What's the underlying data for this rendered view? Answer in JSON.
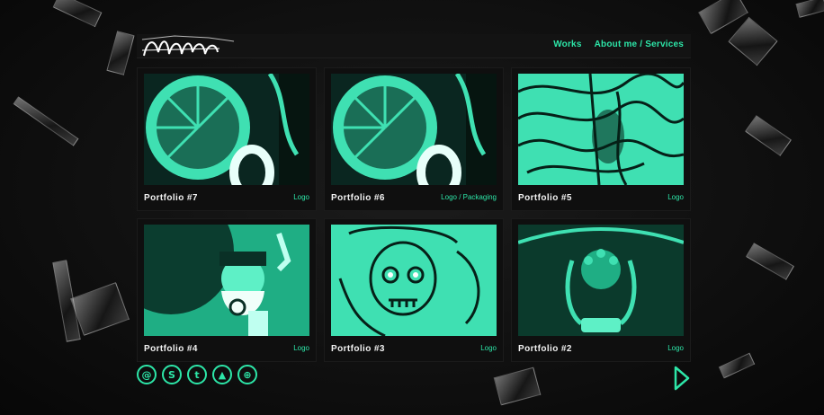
{
  "site": {
    "logo_alt": "logo"
  },
  "nav": {
    "items": [
      {
        "label": "Works"
      },
      {
        "label": "About me / Services"
      }
    ]
  },
  "colors": {
    "accent": "#2de6a8",
    "background": "#0c0c0c",
    "card": "#0f0f0f"
  },
  "portfolio": [
    {
      "title": "Portfolio #7",
      "category": "Logo"
    },
    {
      "title": "Portfolio #6",
      "category": "Logo / Packaging"
    },
    {
      "title": "Portfolio #5",
      "category": "Logo"
    },
    {
      "title": "Portfolio #4",
      "category": "Logo"
    },
    {
      "title": "Portfolio #3",
      "category": "Logo"
    },
    {
      "title": "Portfolio #2",
      "category": "Logo"
    }
  ],
  "social": [
    {
      "icon": "at-icon",
      "glyph": "@"
    },
    {
      "icon": "skype-icon",
      "glyph": "S"
    },
    {
      "icon": "twitter-icon",
      "glyph": "t"
    },
    {
      "icon": "behance-icon",
      "glyph": "▲"
    },
    {
      "icon": "dribbble-icon",
      "glyph": "⊕"
    }
  ],
  "pager": {
    "next_icon": "next-arrow-icon"
  }
}
